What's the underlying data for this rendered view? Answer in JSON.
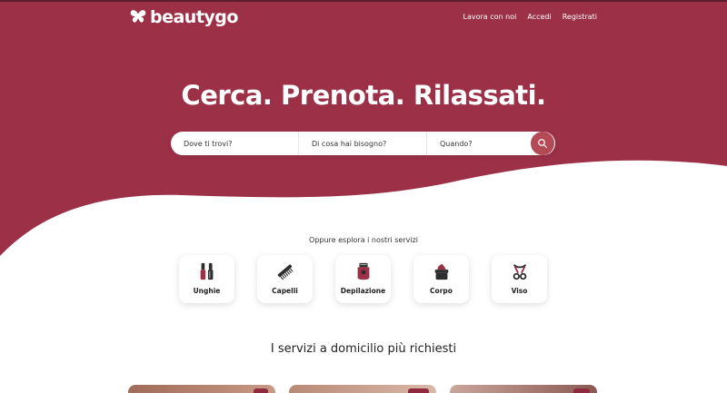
{
  "brand": {
    "name": "beautygo",
    "color": "#9b3047"
  },
  "nav": {
    "items": [
      "Lavora con noi",
      "Accedi",
      "Registrati"
    ]
  },
  "hero": {
    "headline": "Cerca. Prenota. Rilassati."
  },
  "search": {
    "where_placeholder": "Dove ti trovi?",
    "what_placeholder": "Di cosa hai bisogno?",
    "when_placeholder": "Quando?",
    "button_icon": "search-icon"
  },
  "explore": {
    "label": "Oppure esplora i nostri servizi",
    "services": [
      {
        "label": "Unghie",
        "icon": "nail-polish-icon"
      },
      {
        "label": "Capelli",
        "icon": "comb-icon"
      },
      {
        "label": "Depilazione",
        "icon": "epilator-icon"
      },
      {
        "label": "Corpo",
        "icon": "cream-jar-icon"
      },
      {
        "label": "Viso",
        "icon": "eyelash-curler-icon"
      }
    ]
  },
  "popular": {
    "title": "I servizi a domicilio più richiesti"
  }
}
